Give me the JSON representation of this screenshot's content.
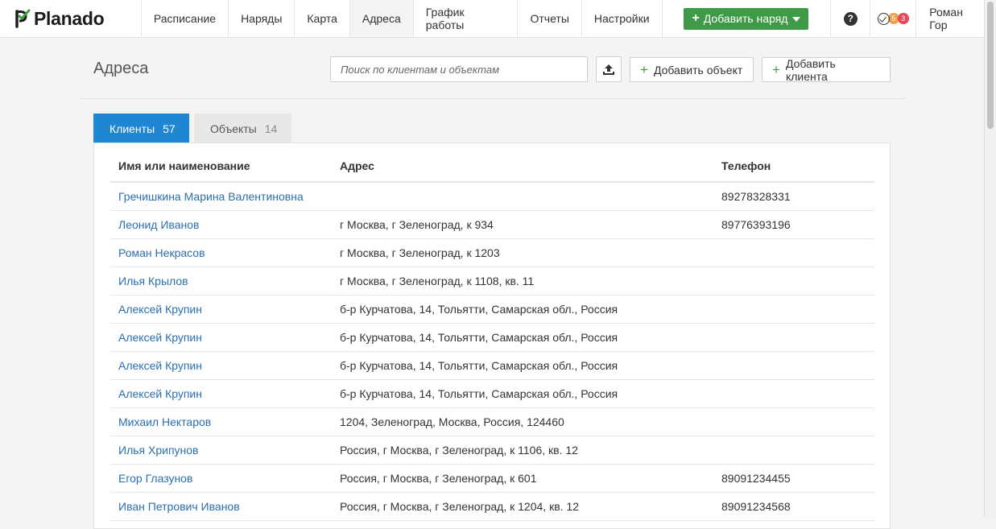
{
  "brand": {
    "name": "Planado"
  },
  "nav": {
    "items": [
      {
        "label": "Расписание"
      },
      {
        "label": "Наряды"
      },
      {
        "label": "Карта"
      },
      {
        "label": "Адреса",
        "active": true
      },
      {
        "label": "График работы"
      },
      {
        "label": "Отчеты"
      },
      {
        "label": "Настройки"
      }
    ],
    "add_order_label": "Добавить наряд",
    "help_label": "?",
    "notifications": {
      "orange": "5",
      "red": "3"
    },
    "user_name": "Роман Гор"
  },
  "page": {
    "title": "Адреса",
    "search_placeholder": "Поиск по клиентам и объектам",
    "add_object_label": "Добавить объект",
    "add_client_label": "Добавить клиента"
  },
  "tabs": {
    "clients": {
      "label": "Клиенты",
      "count": "57"
    },
    "objects": {
      "label": "Объекты",
      "count": "14"
    }
  },
  "table": {
    "columns": {
      "name": "Имя или наименование",
      "address": "Адрес",
      "phone": "Телефон"
    },
    "rows": [
      {
        "name": "Гречишкина Марина Валентиновна",
        "address": "",
        "phone": "89278328331"
      },
      {
        "name": "Леонид Иванов",
        "address": "г Москва, г Зеленоград, к 934",
        "phone": "89776393196"
      },
      {
        "name": "Роман Некрасов",
        "address": "г Москва, г Зеленоград, к 1203",
        "phone": ""
      },
      {
        "name": "Илья Крылов",
        "address": "г Москва, г Зеленоград, к 1108, кв. 11",
        "phone": ""
      },
      {
        "name": "Алексей Крупин",
        "address": "б-р Курчатова, 14, Тольятти, Самарская обл., Россия",
        "phone": ""
      },
      {
        "name": "Алексей Крупин",
        "address": "б-р Курчатова, 14, Тольятти, Самарская обл., Россия",
        "phone": ""
      },
      {
        "name": "Алексей Крупин",
        "address": "б-р Курчатова, 14, Тольятти, Самарская обл., Россия",
        "phone": ""
      },
      {
        "name": "Алексей Крупин",
        "address": "б-р Курчатова, 14, Тольятти, Самарская обл., Россия",
        "phone": ""
      },
      {
        "name": "Михаил Нектаров",
        "address": "1204, Зеленоград, Москва, Россия, 124460",
        "phone": ""
      },
      {
        "name": "Илья Хрипунов",
        "address": "Россия, г Москва, г Зеленоград, к 1106, кв. 12",
        "phone": ""
      },
      {
        "name": "Егор Глазунов",
        "address": "Россия, г Москва, г Зеленоград, к 601",
        "phone": "89091234455"
      },
      {
        "name": "Иван Петрович Иванов",
        "address": "Россия, г Москва, г Зеленоград, к 1204, кв. 12",
        "phone": "89091234568"
      }
    ]
  },
  "colors": {
    "accent": "#1f86d2",
    "brand_green": "#3f9a48",
    "link": "#2a6fb0"
  }
}
